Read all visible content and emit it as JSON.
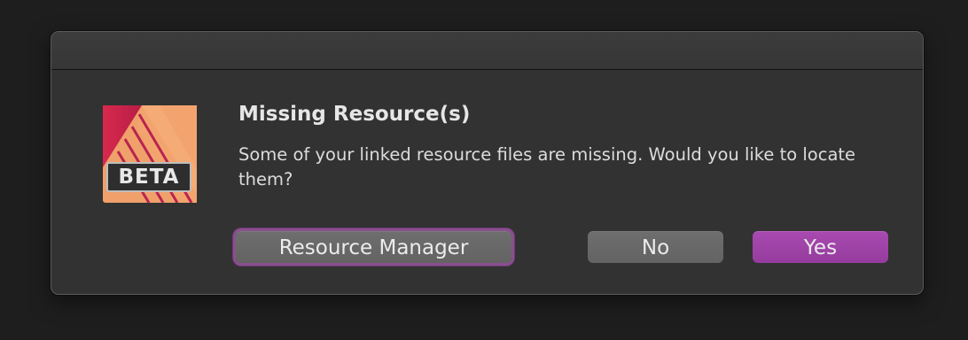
{
  "dialog": {
    "title": "Missing Resource(s)",
    "message": "Some of your linked resource files are missing. Would you like to locate them?",
    "icon": {
      "name": "affinity-publisher-beta-icon",
      "badge_text": "BETA",
      "colors": {
        "primary": "#f2a06a",
        "secondary": "#d6294f"
      }
    },
    "buttons": {
      "resource_manager": "Resource Manager",
      "no": "No",
      "yes": "Yes"
    },
    "colors": {
      "background": "#323232",
      "accent": "#a244aa",
      "focus_ring": "#8a4f8f"
    }
  }
}
